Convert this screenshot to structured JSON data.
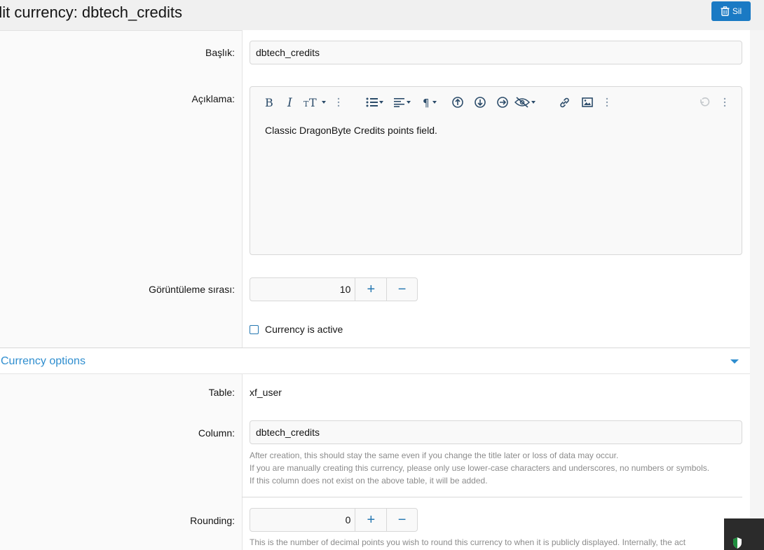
{
  "header": {
    "title": "dit currency: dbtech_credits",
    "delete_label": "Sil"
  },
  "form": {
    "title_label": "Başlık:",
    "title_value": "dbtech_credits",
    "description_label": "Açıklama:",
    "description_value": "Classic DragonByte Credits points field.",
    "display_order_label": "Görüntüleme sırası:",
    "display_order_value": "10",
    "active_label": "Currency is active"
  },
  "toolbar_icons": [
    "bold-icon",
    "italic-icon",
    "text-size-icon",
    "more-vertical-icon",
    "list-icon",
    "align-icon",
    "paragraph-icon",
    "insert-above-icon",
    "insert-below-icon",
    "insert-after-icon",
    "hide-icon",
    "link-icon",
    "image-icon",
    "more-vertical-icon",
    "undo-icon",
    "more-vertical-icon"
  ],
  "options": {
    "section_title": "Currency options",
    "table_label": "Table:",
    "table_value": "xf_user",
    "column_label": "Column:",
    "column_value": "dbtech_credits",
    "column_hints": [
      "After creation, this should stay the same even if you change the title later or loss of data may occur.",
      "If you are manually creating this currency, please only use lower-case characters and underscores, no numbers or symbols.",
      "If this column does not exist on the above table, it will be added."
    ],
    "rounding_label": "Rounding:",
    "rounding_value": "0",
    "rounding_hint": "This is the number of decimal points you wish to round this currency to when it is publicly displayed. Internally, the act"
  },
  "stepper": {
    "plus": "+",
    "minus": "−"
  }
}
